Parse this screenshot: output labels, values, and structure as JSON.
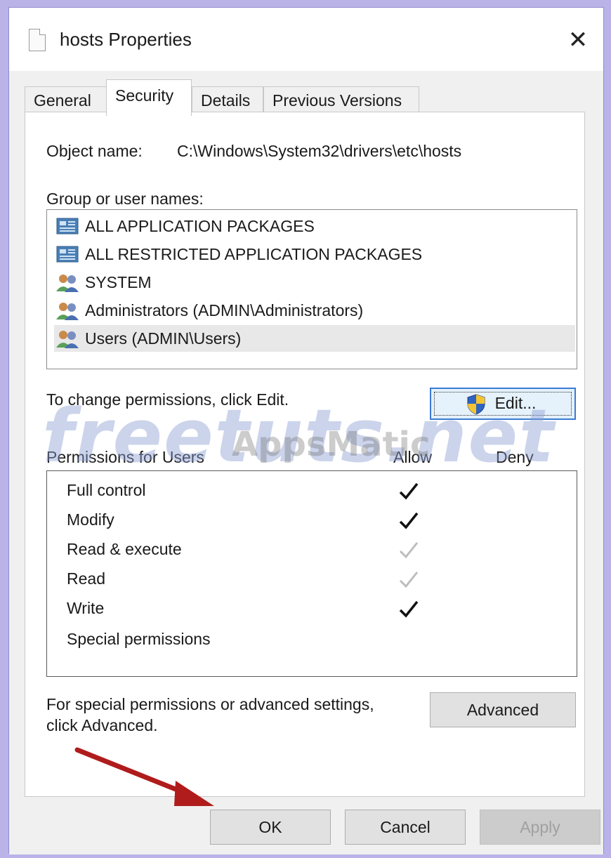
{
  "window": {
    "title": "hosts Properties"
  },
  "tabs": [
    {
      "label": "General",
      "active": false
    },
    {
      "label": "Security",
      "active": true
    },
    {
      "label": "Details",
      "active": false
    },
    {
      "label": "Previous Versions",
      "active": false
    }
  ],
  "security": {
    "object_name_label": "Object name:",
    "object_name_value": "C:\\Windows\\System32\\drivers\\etc\\hosts",
    "group_label": "Group or user names:",
    "groups": [
      {
        "label": "ALL APPLICATION PACKAGES",
        "icon": "app-packages-icon",
        "selected": false
      },
      {
        "label": "ALL RESTRICTED APPLICATION PACKAGES",
        "icon": "app-packages-icon",
        "selected": false
      },
      {
        "label": "SYSTEM",
        "icon": "users-group-icon",
        "selected": false
      },
      {
        "label": "Administrators (ADMIN\\Administrators)",
        "icon": "users-group-icon",
        "selected": false
      },
      {
        "label": "Users (ADMIN\\Users)",
        "icon": "users-group-icon",
        "selected": true
      }
    ],
    "change_hint": "To change permissions, click Edit.",
    "edit_button": "Edit...",
    "permissions_label": "Permissions for Users",
    "allow_header": "Allow",
    "deny_header": "Deny",
    "permissions": [
      {
        "name": "Full control",
        "allow": "checked"
      },
      {
        "name": "Modify",
        "allow": "checked"
      },
      {
        "name": "Read & execute",
        "allow": "inherited"
      },
      {
        "name": "Read",
        "allow": "inherited"
      },
      {
        "name": "Write",
        "allow": "checked"
      },
      {
        "name": "Special permissions",
        "allow": "none"
      }
    ],
    "advanced_hint_line1": "For special permissions or advanced settings,",
    "advanced_hint_line2": "click Advanced.",
    "advanced_button": "Advanced"
  },
  "footer": {
    "ok": "OK",
    "cancel": "Cancel",
    "apply": "Apply"
  },
  "watermark": {
    "main": "freetuts.net",
    "sub": "AppsMatic"
  },
  "colors": {
    "check_dark": "#111111",
    "check_light": "#bdbdbd",
    "focus": "#3a7bd5",
    "arrow": "#b01c1c"
  }
}
